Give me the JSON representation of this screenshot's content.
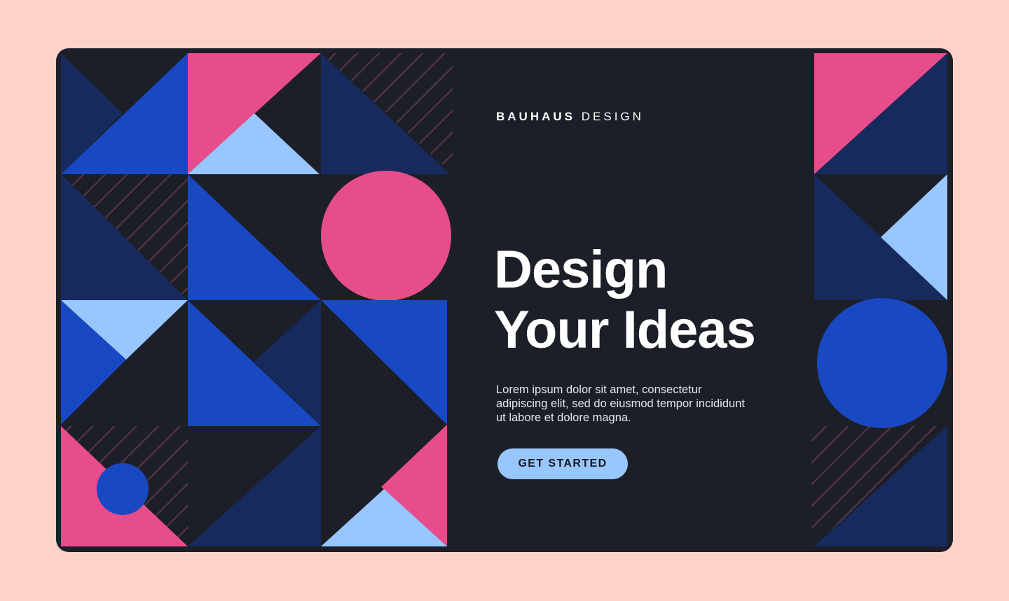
{
  "brand": {
    "bold": "BAUHAUS",
    "light": "DESIGN"
  },
  "hero": {
    "headline_line1": "Design",
    "headline_line2": "Your Ideas",
    "body": "Lorem ipsum dolor sit amet, consectetur adipiscing elit, sed do eiusmod tempor incididunt ut labore et dolore magna."
  },
  "cta": {
    "label": "GET STARTED"
  },
  "colors": {
    "page_background": "#ffd1cb",
    "card_background": "#1c1f27",
    "navy": "#172a5e",
    "royal_blue": "#1848c2",
    "pink": "#e64d8a",
    "light_blue": "#98c6ff",
    "stripe": "#5a3645"
  }
}
